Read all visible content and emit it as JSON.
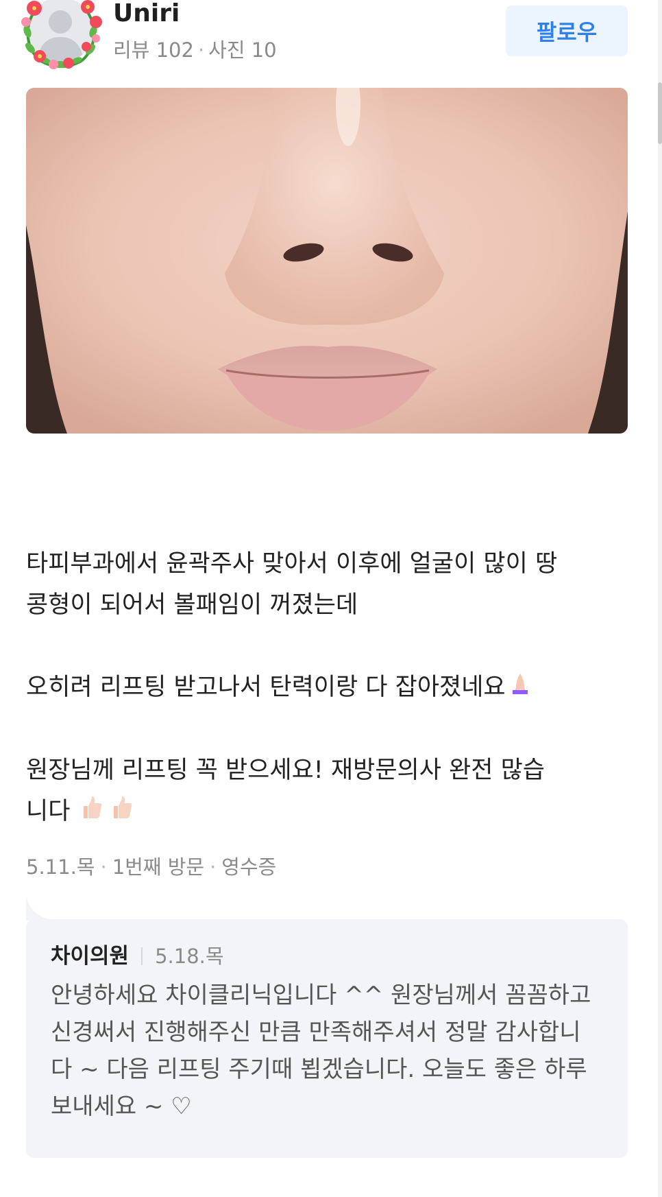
{
  "user": {
    "name": "Uniri",
    "reviews": "리뷰 102",
    "photos": "사진 10",
    "follow_label": "팔로우"
  },
  "review": {
    "line1": "타피부과에서 윤곽주사 맞아서 이후에 얼굴이 많이 땅",
    "line2": "콩형이 되어서 볼패임이 꺼졌는데",
    "line3": "오히려 리프팅 받고나서 탄력이랑 다 잡아졌네요",
    "line4": "원장님께 리프팅 꼭 받으세요! 재방문의사 완전 많습",
    "line5": "니다",
    "date": "5.11.목",
    "visit": "1번째 방문",
    "receipt": "영수증"
  },
  "reply": {
    "name": "차이의원",
    "date": "5.18.목",
    "text": "안녕하세요 차이클리닉입니다 ^^ 원장님께서 꼼꼼하고 신경써서 진행해주신 만큼 만족해주셔서 정말 감사합니다 ~ 다음 리프팅 주기때 뵙겠습니다. 오늘도 좋은 하루 보내세요 ~ ♡"
  },
  "colors": {
    "follow_text": "#2f80ed",
    "follow_bg": "#ecf4fd",
    "reply_bg": "#f2f4f7",
    "meta_gray": "#8a8a8a"
  },
  "icons": {
    "avatar": "default-user-avatar-with-flower-wreath",
    "emoji_1": "folded-hands-emoji",
    "emoji_2": "thumbs-up-emoji"
  }
}
